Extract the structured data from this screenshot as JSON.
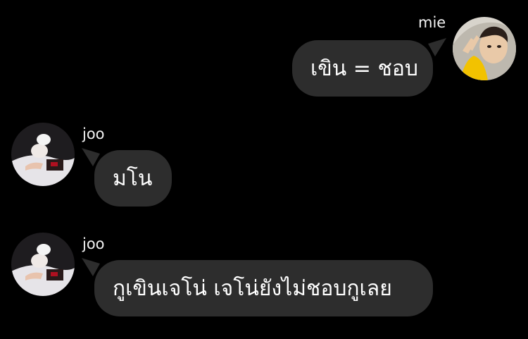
{
  "messages": [
    {
      "sender": "mie",
      "side": "right",
      "text": "เขิน = ชอบ",
      "avatar": "avatar-mie"
    },
    {
      "sender": "joo",
      "side": "left",
      "text": "มโน",
      "avatar": "avatar-joo"
    },
    {
      "sender": "joo",
      "side": "left",
      "text": "กูเขินเจโน่ เจโน่ยังไม่ชอบกูเลย",
      "avatar": "avatar-joo"
    }
  ],
  "colors": {
    "background": "#000000",
    "bubble": "#2d2d2d",
    "text": "#ffffff"
  }
}
